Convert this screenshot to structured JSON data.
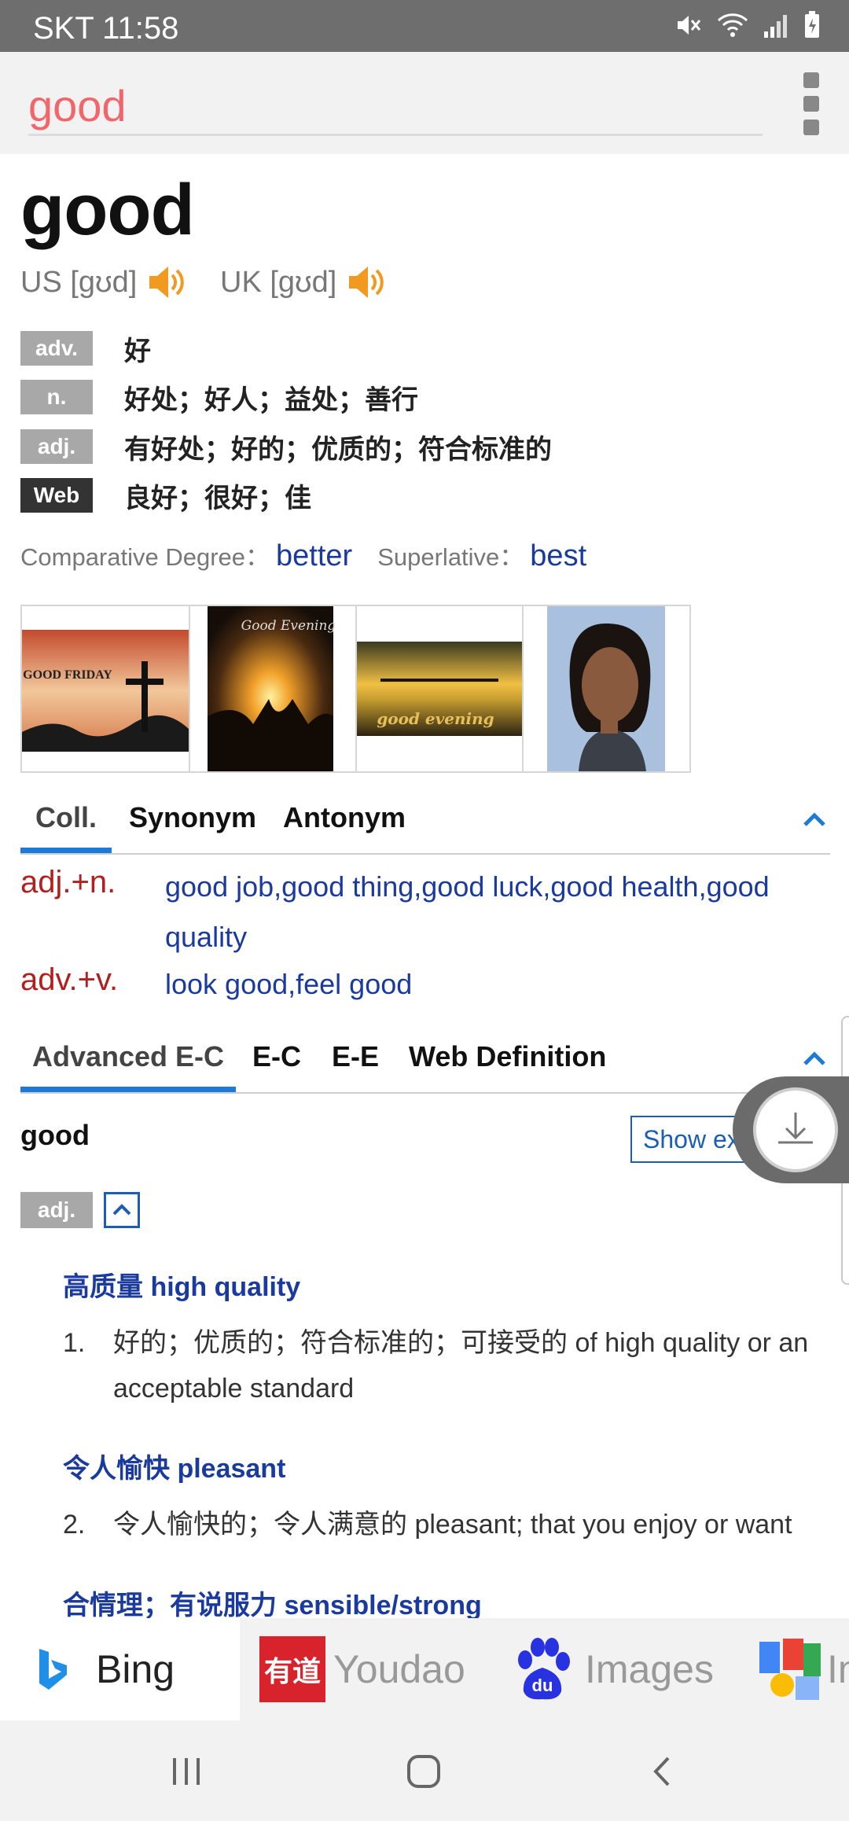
{
  "status": {
    "carrier_time": "SKT 11:58"
  },
  "search": {
    "query": "good"
  },
  "entry": {
    "headword": "good",
    "pron_us": "US [gʊd]",
    "pron_uk": "UK [gʊd]",
    "defs": [
      {
        "pos": "adv.",
        "text": "好"
      },
      {
        "pos": "n.",
        "text": "好处；好人；益处；善行"
      },
      {
        "pos": "adj.",
        "text": "有好处；好的；优质的；符合标准的"
      },
      {
        "pos": "Web",
        "text": "良好；很好；佳"
      }
    ],
    "comparative_label": "Comparative Degree：",
    "comparative_value": "better",
    "superlative_label": "Superlative：",
    "superlative_value": "best"
  },
  "images": [
    {
      "caption": "GOOD FRIDAY"
    },
    {
      "caption": "Good Evening"
    },
    {
      "caption": "good evening"
    }
  ],
  "coll_tabs": [
    "Coll.",
    "Synonym",
    "Antonym"
  ],
  "collocations": [
    {
      "pos": "adj.+n.",
      "values": "good job,good thing,good luck,good health,good quality"
    },
    {
      "pos": "adv.+v.",
      "values": "look good,feel good"
    }
  ],
  "def_tabs": [
    "Advanced E-C",
    "E-C",
    "E-E",
    "Web Definition"
  ],
  "advanced": {
    "word": "good",
    "show_examples": "Show exa",
    "pos": "adj.",
    "senses": [
      {
        "head": "高质量 high quality",
        "num": "1.",
        "text": "好的；优质的；符合标准的；可接受的 of high quality or an acceptable standard"
      },
      {
        "head": "令人愉快 pleasant",
        "num": "2.",
        "text": "令人愉快的；令人满意的 pleasant; that you enjoy or want"
      },
      {
        "head": "合情理；有说服力 sensible/strong"
      }
    ]
  },
  "engines": [
    "Bing",
    "Youdao",
    "Images",
    "Im"
  ],
  "engine_logos": {
    "youdao": "有道",
    "baidu": "du"
  },
  "colors": {
    "accent": "#1d7bd6",
    "link": "#1a3a9e",
    "pos_red": "#b21f1f",
    "query": "#f0666a"
  }
}
